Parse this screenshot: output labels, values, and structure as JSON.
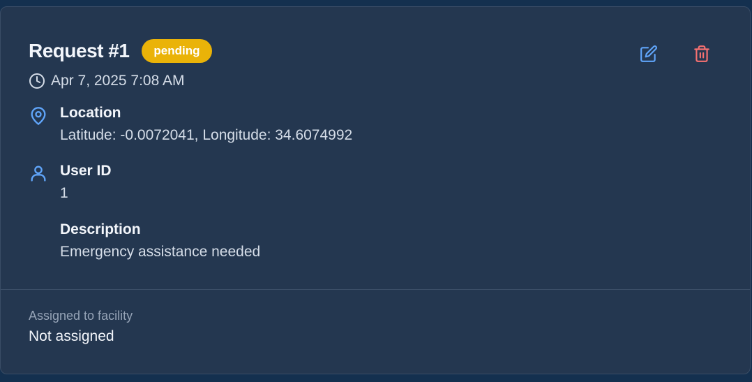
{
  "request": {
    "title": "Request #1",
    "status": "pending",
    "timestamp": "Apr 7, 2025 7:08 AM"
  },
  "actions": {
    "edit_icon": "edit-icon",
    "delete_icon": "trash-icon"
  },
  "fields": {
    "location": {
      "label": "Location",
      "value": "Latitude: -0.0072041, Longitude: 34.6074992",
      "icon": "map-pin-icon"
    },
    "user": {
      "label": "User ID",
      "value": "1",
      "icon": "user-icon"
    },
    "description": {
      "label": "Description",
      "value": "Emergency assistance needed"
    }
  },
  "facility": {
    "label": "Assigned to facility",
    "value": "Not assigned"
  },
  "colors": {
    "page_background": "#14304f",
    "card_background": "#243750",
    "badge_pending": "#eab308",
    "icon_blue": "#60a5fa",
    "icon_red": "#f87171"
  }
}
